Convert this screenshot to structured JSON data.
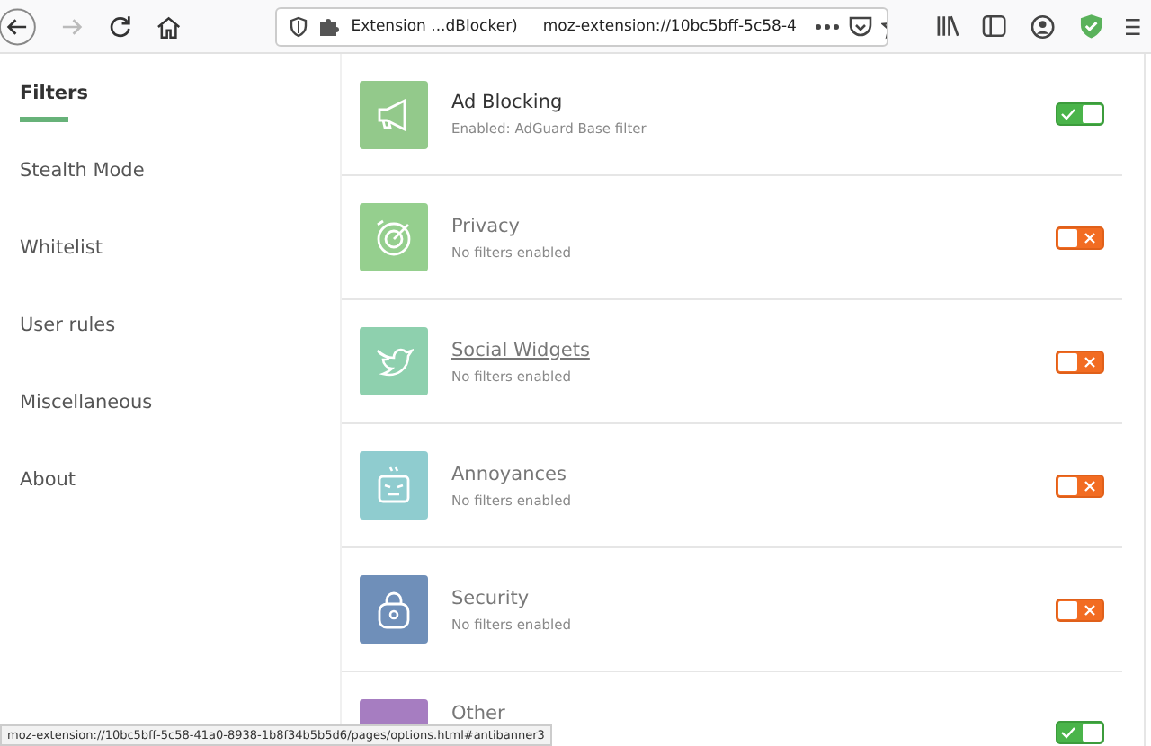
{
  "toolbar": {
    "tab_title": "Extension ...dBlocker)",
    "url": "moz-extension://10bc5bff-5c58-4",
    "forward_disabled": true
  },
  "sidebar": {
    "items": [
      {
        "label": "Filters",
        "selected": true
      },
      {
        "label": "Stealth Mode",
        "selected": false
      },
      {
        "label": "Whitelist",
        "selected": false
      },
      {
        "label": "User rules",
        "selected": false
      },
      {
        "label": "Miscellaneous",
        "selected": false
      },
      {
        "label": "About",
        "selected": false
      }
    ]
  },
  "groups": [
    {
      "kind": "megaphone",
      "title": "Ad Blocking",
      "subtitle": "Enabled: AdGuard Base filter",
      "on": true,
      "hovered": false,
      "color": "#93c98b"
    },
    {
      "kind": "target",
      "title": "Privacy",
      "subtitle": "No filters enabled",
      "on": false,
      "hovered": false,
      "color": "#95cf8e"
    },
    {
      "kind": "bird",
      "title": "Social Widgets",
      "subtitle": "No filters enabled",
      "on": false,
      "hovered": true,
      "color": "#8ed0ae"
    },
    {
      "kind": "face",
      "title": "Annoyances",
      "subtitle": "No filters enabled",
      "on": false,
      "hovered": false,
      "color": "#8fcccf"
    },
    {
      "kind": "lock",
      "title": "Security",
      "subtitle": "No filters enabled",
      "on": false,
      "hovered": false,
      "color": "#6f8fb9"
    },
    {
      "kind": "blank",
      "title": "Other",
      "on": true,
      "hovered": false,
      "color": "#a67dc1"
    }
  ],
  "status_bar": "moz-extension://10bc5bff-5c58-41a0-8938-1b8f34b5b5d6/pages/options.html#antibanner3"
}
